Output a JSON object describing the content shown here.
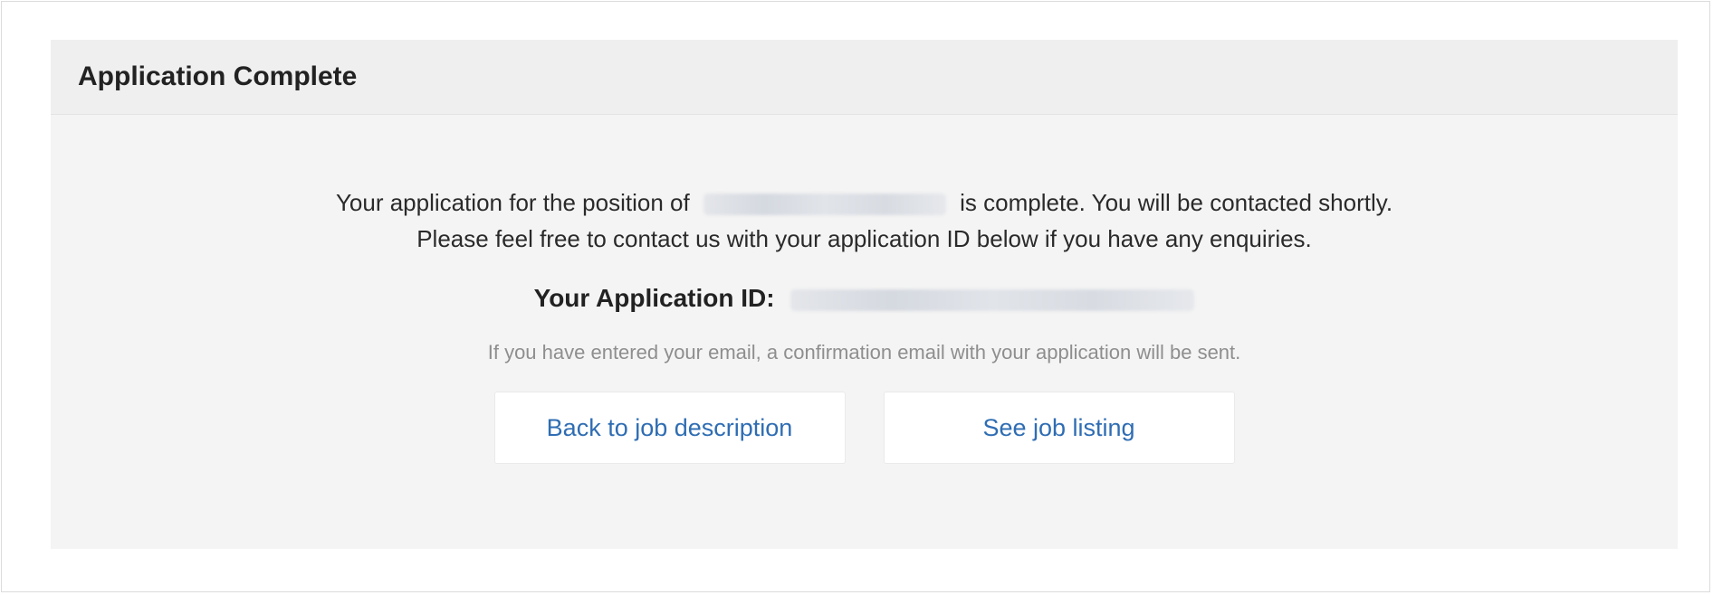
{
  "panel": {
    "title": "Application Complete"
  },
  "message": {
    "line1_prefix": "Your application for the position of",
    "line1_suffix": "is complete. You will be contacted shortly.",
    "line2": "Please feel free to contact us with your application ID below if you have any enquiries."
  },
  "application_id": {
    "label": "Your Application ID:"
  },
  "note": "If you have entered your email, a confirmation email with your application will be sent.",
  "buttons": {
    "back_label": "Back to job description",
    "listing_label": "See job listing"
  },
  "colors": {
    "link": "#2f6db3",
    "panel_bg": "#f4f4f4",
    "header_bg": "#efefef"
  }
}
